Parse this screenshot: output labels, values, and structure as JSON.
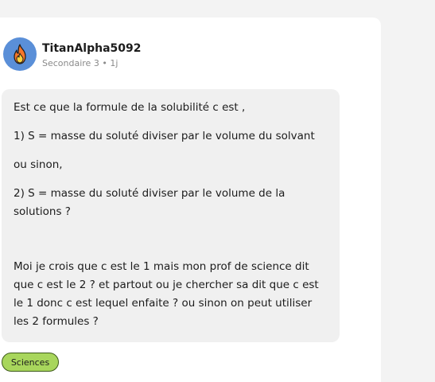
{
  "post": {
    "author": {
      "username": "TitanAlpha5092",
      "grade": "Secondaire 3",
      "separator": "•",
      "time_ago": "1j",
      "avatar_icon": "fire-icon",
      "avatar_color": "#5a8fd8"
    },
    "body": {
      "p1": "Est ce que la formule de la solubilité c est ,",
      "p2": "1) S = masse du soluté diviser par le volume du solvant",
      "p3": "ou sinon,",
      "p4": "2) S = masse du soluté diviser par le volume de la solutions ?",
      "p5": "Moi je crois que c est le 1 mais mon prof de science dit que c est le 2 ? et partout ou je chercher sa dit que c est le 1 donc c est lequel enfaite ? ou sinon on peut utiliser les 2 formules ?"
    },
    "subject_tag": {
      "label": "Sciences",
      "color": "#a8d65c"
    }
  }
}
